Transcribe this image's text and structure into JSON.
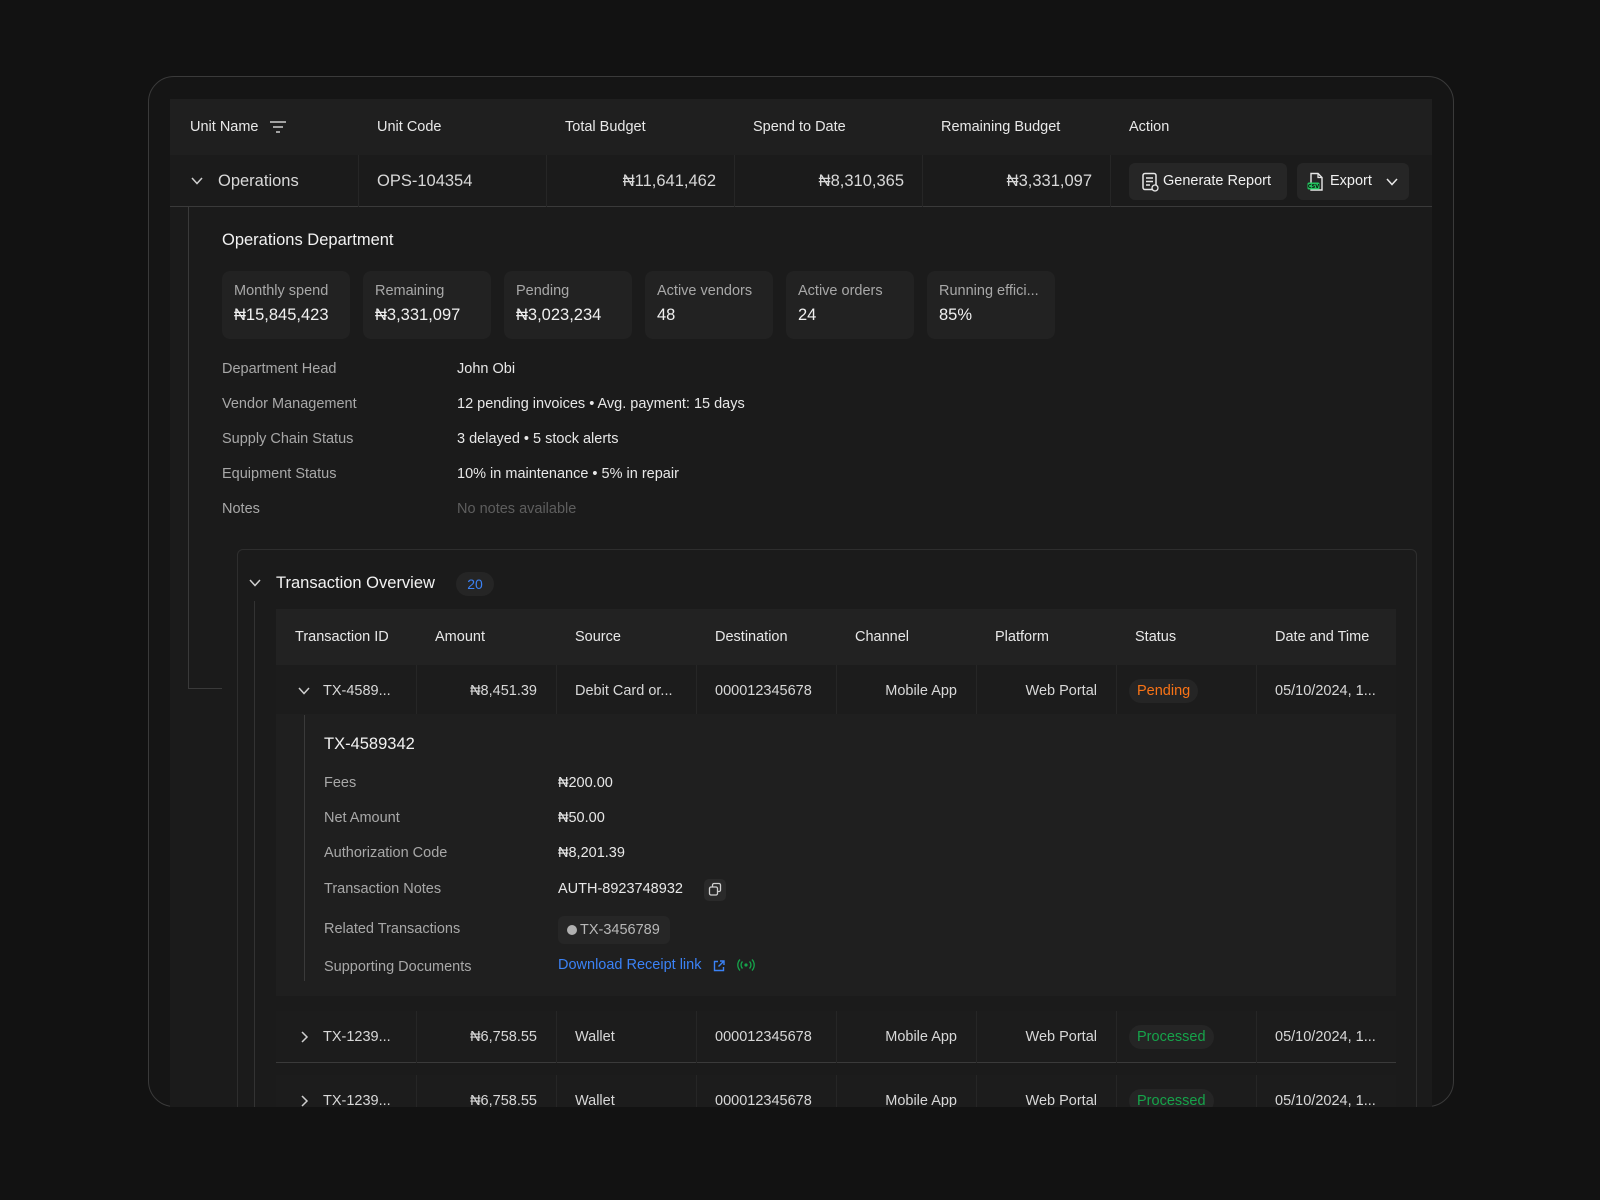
{
  "table": {
    "headers": [
      "Unit Name",
      "Unit Code",
      "Total Budget",
      "Spend to Date",
      "Remaining Budget",
      "Action"
    ],
    "row": {
      "unit_name": "Operations",
      "unit_code": "OPS-104354",
      "total_budget": "₦11,641,462",
      "spend_to_date": "₦8,310,365",
      "remaining_budget": "₦3,331,097",
      "generate_report_label": "Generate Report",
      "export_label": "Export"
    }
  },
  "department": {
    "title": "Operations Department",
    "stats": [
      {
        "label": "Monthly spend",
        "value": "₦15,845,423"
      },
      {
        "label": "Remaining",
        "value": "₦3,331,097"
      },
      {
        "label": "Pending",
        "value": "₦3,023,234"
      },
      {
        "label": "Active vendors",
        "value": "48"
      },
      {
        "label": "Active orders",
        "value": "24"
      },
      {
        "label": "Running effici...",
        "value": "85%"
      }
    ],
    "info": [
      {
        "label": "Department Head",
        "value": "John Obi"
      },
      {
        "label": "Vendor Management",
        "value": "12 pending invoices • Avg. payment: 15 days"
      },
      {
        "label": "Supply Chain Status",
        "value": "3 delayed • 5 stock alerts"
      },
      {
        "label": "Equipment Status",
        "value": "10% in maintenance • 5% in repair"
      },
      {
        "label": "Notes",
        "value": "No notes available"
      }
    ]
  },
  "transactions": {
    "title": "Transaction Overview",
    "count": "20",
    "headers": [
      "Transaction ID",
      "Amount",
      "Source",
      "Destination",
      "Channel",
      "Platform",
      "Status",
      "Date and Time"
    ],
    "rows": [
      {
        "id": "TX-4589...",
        "amount": "₦8,451.39",
        "source": "Debit Card or...",
        "destination": "000012345678",
        "channel": "Mobile App",
        "platform": "Web Portal",
        "status": "Pending",
        "datetime": "05/10/2024, 1..."
      },
      {
        "id": "TX-1239...",
        "amount": "₦6,758.55",
        "source": "Wallet",
        "destination": "000012345678",
        "channel": "Mobile App",
        "platform": "Web Portal",
        "status": "Processed",
        "datetime": "05/10/2024, 1..."
      },
      {
        "id": "TX-1239...",
        "amount": "₦6,758.55",
        "source": "Wallet",
        "destination": "000012345678",
        "channel": "Mobile App",
        "platform": "Web Portal",
        "status": "Processed",
        "datetime": "05/10/2024, 1..."
      }
    ],
    "detail": {
      "title": "TX-4589342",
      "fields": [
        {
          "label": "Fees",
          "value": "₦200.00"
        },
        {
          "label": "Net Amount",
          "value": "₦50.00"
        },
        {
          "label": "Authorization Code",
          "value": "₦8,201.39"
        },
        {
          "label": "Transaction Notes",
          "value": "AUTH-8923748932"
        },
        {
          "label": "Related Transactions",
          "value": "TX-3456789"
        },
        {
          "label": "Supporting Documents",
          "value": "Download Receipt link"
        }
      ]
    }
  },
  "colors": {
    "pending": "#f97316",
    "processed": "#16a34a",
    "link": "#3b82f6",
    "csv": "#22c55e"
  }
}
